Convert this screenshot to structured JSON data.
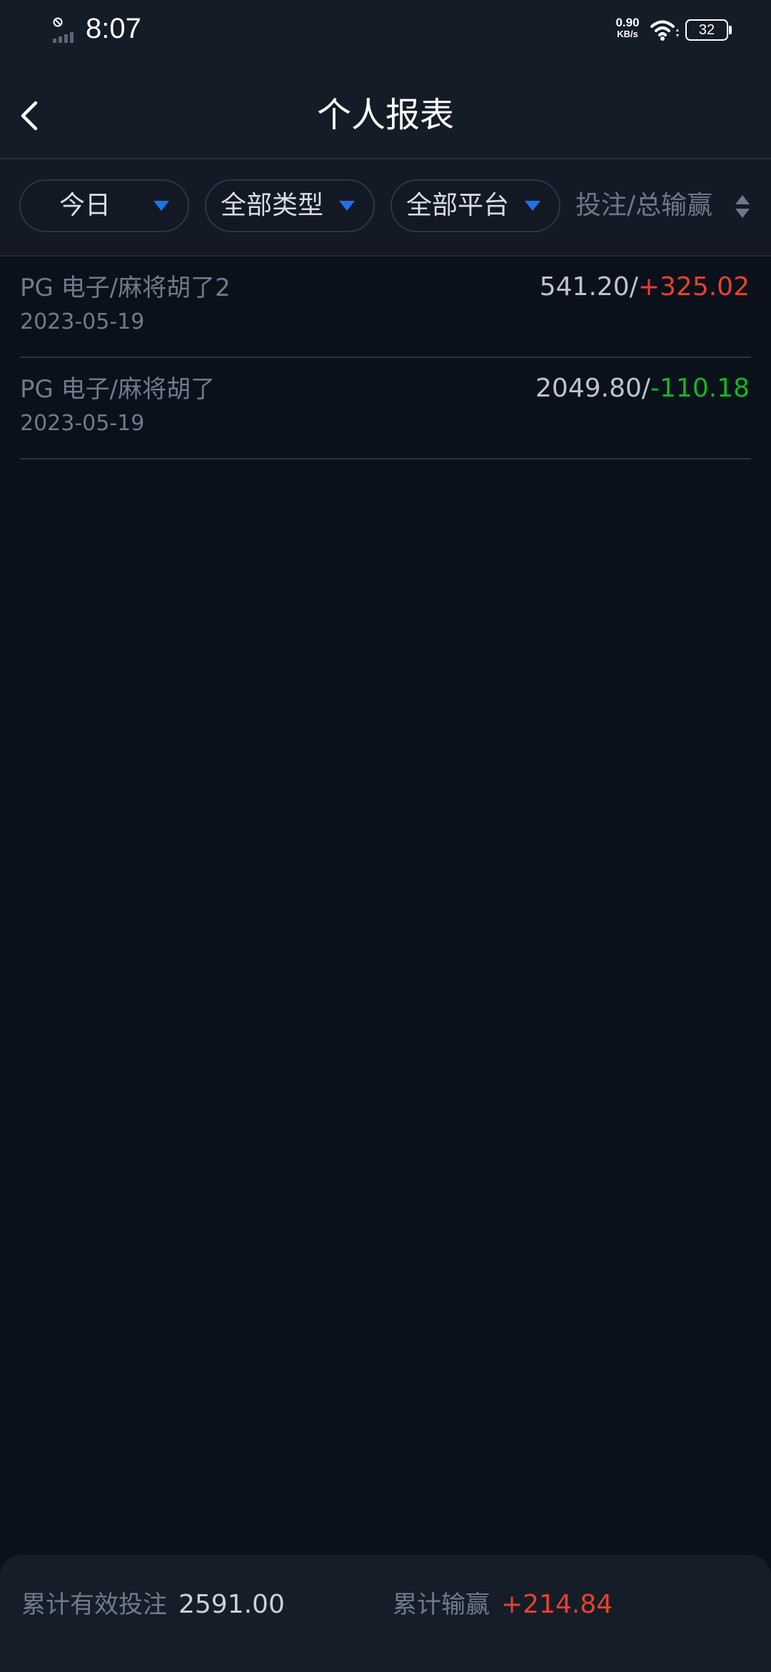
{
  "status_bar": {
    "time": "8:07",
    "net_speed_value": "0.90",
    "net_speed_unit": "KB/s",
    "battery": "32",
    "icons": [
      "do-not-disturb-icon",
      "signal-icon",
      "wifi-icon",
      "battery-icon"
    ]
  },
  "header": {
    "title": "个人报表",
    "back_icon": "chevron-left-icon"
  },
  "filters": {
    "period": "今日",
    "type": "全部类型",
    "platform": "全部平台",
    "sort_label": "投注/总输赢",
    "caret_color": "#1a72f0"
  },
  "records": [
    {
      "name": "PG  电子/麻将胡了2",
      "date": "2023-05-19",
      "bet": "541.20",
      "separator": "/",
      "result": "+325.02",
      "result_type": "win"
    },
    {
      "name": "PG  电子/麻将胡了",
      "date": "2023-05-19",
      "bet": "2049.80",
      "separator": "/",
      "result": "-110.18",
      "result_type": "loss"
    }
  ],
  "summary": {
    "total_bet_label": "累计有效投注",
    "total_bet_value": "2591.00",
    "total_win_label": "累计输赢",
    "total_win_value": "+214.84"
  },
  "colors": {
    "background": "#0b111b",
    "header": "#141c27",
    "win": "#e8412f",
    "loss": "#12b624",
    "accent": "#1a72f0"
  }
}
